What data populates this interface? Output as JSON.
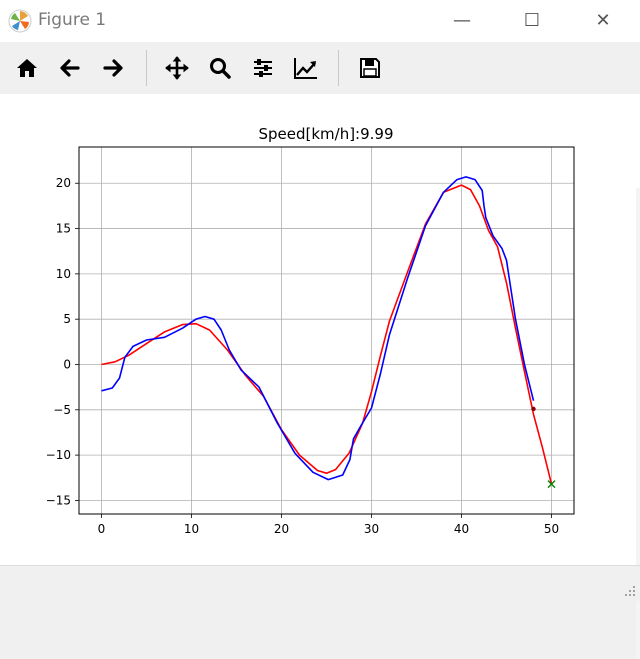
{
  "window": {
    "title": "Figure 1",
    "minimize_glyph": "—",
    "maximize_glyph": "☐",
    "close_glyph": "✕"
  },
  "toolbar": {
    "buttons": [
      {
        "name": "home",
        "icon": "home-icon"
      },
      {
        "name": "back",
        "icon": "arrow-left-icon"
      },
      {
        "name": "forward",
        "icon": "arrow-right-icon"
      },
      {
        "name": "pan",
        "icon": "move-icon"
      },
      {
        "name": "zoom",
        "icon": "magnifier-icon"
      },
      {
        "name": "configure-subplots",
        "icon": "sliders-icon"
      },
      {
        "name": "edit-axis",
        "icon": "chart-line-icon"
      },
      {
        "name": "save",
        "icon": "floppy-disk-icon"
      }
    ]
  },
  "chart_data": {
    "type": "line",
    "title": "Speed[km/h]:9.99",
    "xlabel": "",
    "ylabel": "",
    "xlim": [
      -2.5,
      52.5
    ],
    "ylim": [
      -16.5,
      24
    ],
    "xticks": [
      0,
      10,
      20,
      30,
      40,
      50
    ],
    "yticks": [
      -15,
      -10,
      -5,
      0,
      5,
      10,
      15,
      20
    ],
    "grid": true,
    "colors": {
      "course": "#ff0000",
      "trajectory": "#0000ff",
      "vehicle": "#8b0000",
      "goal": "#008000"
    },
    "series": [
      {
        "color": "#ff0000",
        "x": [
          0,
          1.5,
          3,
          5,
          7,
          9,
          10.5,
          12,
          14,
          16,
          18,
          20,
          22,
          24,
          25,
          26,
          27.5,
          29,
          30,
          31,
          32,
          34,
          36,
          38,
          40,
          41,
          42,
          43,
          44,
          45,
          46,
          47,
          48,
          49,
          50
        ],
        "y": [
          0,
          0.3,
          1.0,
          2.3,
          3.6,
          4.4,
          4.5,
          3.8,
          1.6,
          -1.2,
          -3.5,
          -7.2,
          -10.0,
          -11.7,
          -12.0,
          -11.6,
          -9.8,
          -6.5,
          -3.0,
          1.0,
          4.8,
          10.2,
          15.5,
          19.0,
          19.8,
          19.3,
          17.5,
          14.8,
          13.0,
          9.0,
          4.0,
          -0.8,
          -5.5,
          -9.2,
          -13.2
        ]
      },
      {
        "color": "#0000ff",
        "x": [
          0,
          1.2,
          2.0,
          2.6,
          3.5,
          5,
          7,
          9,
          10.5,
          11.5,
          12.5,
          13.3,
          14.2,
          15.5,
          17.5,
          19.5,
          21.5,
          23.5,
          25.2,
          26.8,
          27.6,
          28,
          28.8,
          30,
          31,
          32,
          34,
          36,
          38,
          39.5,
          40.5,
          41.5,
          42.3,
          42.5,
          42.7,
          43.5,
          44.5,
          45,
          46,
          47,
          48
        ],
        "y": [
          -2.9,
          -2.6,
          -1.5,
          0.8,
          2.0,
          2.7,
          3.0,
          4.0,
          5.0,
          5.3,
          5.0,
          3.8,
          1.6,
          -0.6,
          -2.5,
          -6.4,
          -9.8,
          -11.9,
          -12.7,
          -12.2,
          -10.5,
          -8.2,
          -6.8,
          -4.8,
          -1.0,
          3.3,
          9.5,
          15.3,
          19.0,
          20.4,
          20.7,
          20.4,
          19.2,
          17.5,
          16.2,
          14.2,
          12.8,
          11.5,
          5.0,
          0,
          -4.0
        ]
      }
    ],
    "markers": [
      {
        "label": "",
        "x": 48,
        "y": -4.9,
        "symbol": "dot",
        "color": "#8b0000"
      },
      {
        "label": "",
        "x": 50,
        "y": -13.2,
        "symbol": "x",
        "color": "#008000"
      }
    ]
  }
}
